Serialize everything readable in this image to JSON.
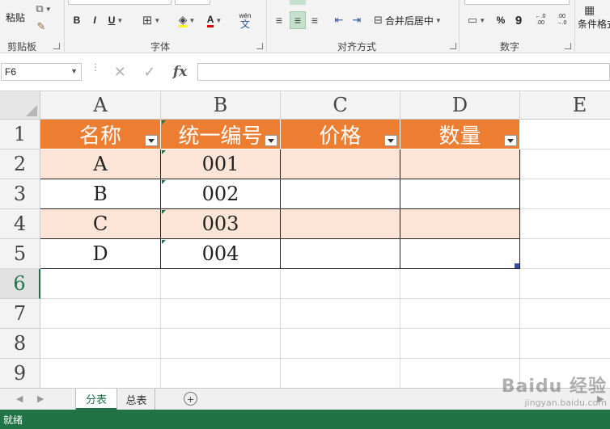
{
  "ribbon": {
    "clipboard": {
      "paste_label": "粘贴",
      "group_label": "剪贴板"
    },
    "font": {
      "group_label": "字体",
      "bold": "B",
      "italic": "I",
      "underline": "U",
      "font_color_glyph": "A",
      "wen": "wén",
      "wen_char": "文"
    },
    "alignment": {
      "group_label": "对齐方式",
      "merge_label": "合并后居中"
    },
    "number": {
      "group_label": "数字",
      "percent": "%",
      "comma": "9",
      "inc_decimal": "←.0 .00",
      "dec_decimal": ".00 →.0"
    },
    "styles": {
      "cond_format_label": "条件格式"
    }
  },
  "formula_bar": {
    "name_box": "F6",
    "cancel_glyph": "✕",
    "enter_glyph": "✓",
    "fx_label": "fx",
    "formula": ""
  },
  "columns": [
    "A",
    "B",
    "C",
    "D",
    "E"
  ],
  "rows": [
    "1",
    "2",
    "3",
    "4",
    "5",
    "6",
    "7",
    "8",
    "9"
  ],
  "table": {
    "headers": [
      "名称",
      "统一编号",
      "价格",
      "数量"
    ],
    "data": [
      [
        "A",
        "001",
        "",
        ""
      ],
      [
        "B",
        "002",
        "",
        ""
      ],
      [
        "C",
        "003",
        "",
        ""
      ],
      [
        "D",
        "004",
        "",
        ""
      ]
    ]
  },
  "sheets": {
    "tabs": [
      "分表",
      "总表"
    ],
    "active": "分表",
    "add_glyph": "+"
  },
  "status": {
    "text": "就绪"
  },
  "watermark": {
    "line1": "Baidu 经验",
    "line2": "jingyan.baidu.com"
  },
  "colors": {
    "header": "#ed7d31",
    "band": "#fce4d6",
    "excel_green": "#217346"
  }
}
